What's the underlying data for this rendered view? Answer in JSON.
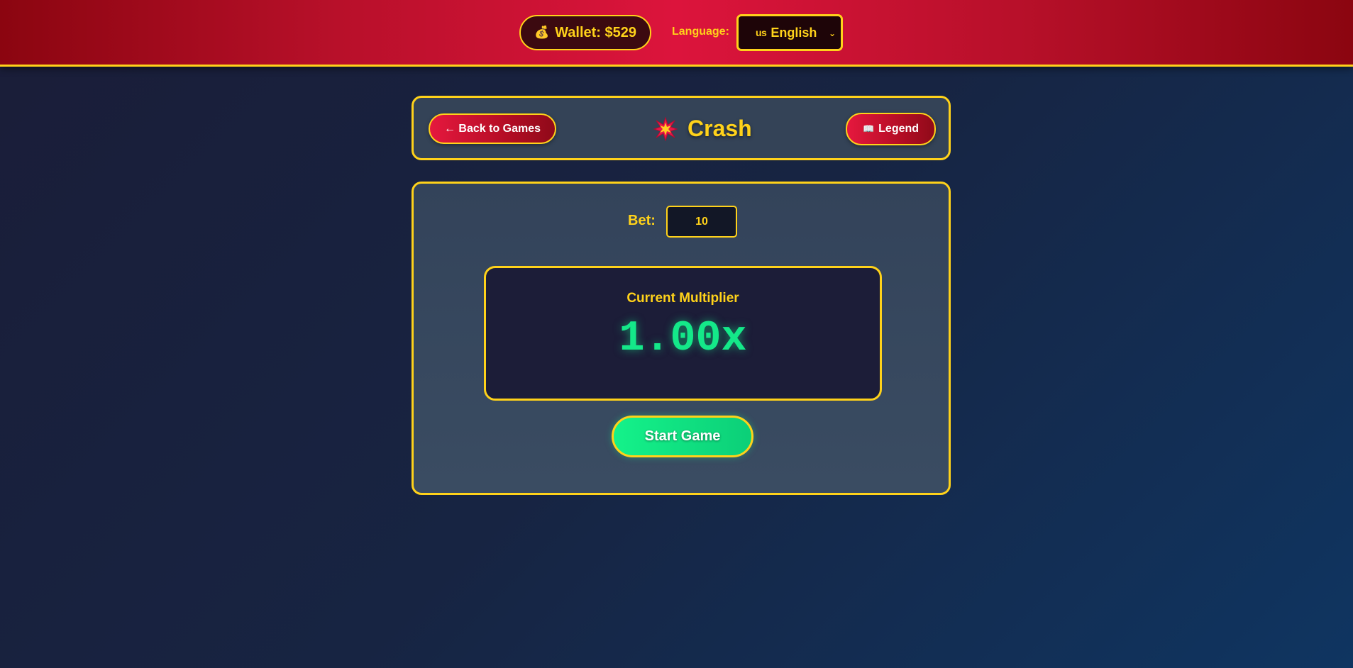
{
  "header": {
    "wallet_icon": "money-bag-icon",
    "wallet_label": "Wallet: $529",
    "language_label": "Language:",
    "language_flag": "us",
    "language_selected": "English"
  },
  "game": {
    "back_label": "← Back to Games",
    "title_icon": "explosion-icon",
    "title": "Crash",
    "legend_icon": "book-icon",
    "legend_label": "Legend",
    "bet_label": "Bet:",
    "bet_value": "10",
    "multiplier_label": "Current Multiplier",
    "multiplier_value": "1.00x",
    "start_label": "Start Game"
  },
  "colors": {
    "accent": "#ffd21a",
    "header_red": "#dc143c",
    "multiplier_green": "#14e889",
    "panel": "#344357",
    "background": "#1a1d38"
  }
}
